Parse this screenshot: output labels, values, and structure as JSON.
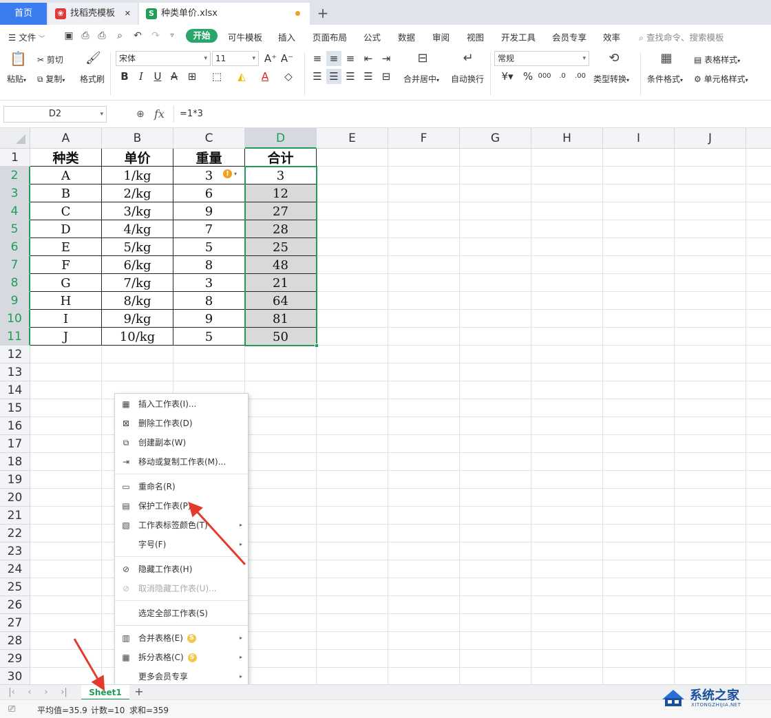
{
  "tabs": {
    "home": "首页",
    "template": "找稻壳模板",
    "file": "种类单价.xlsx",
    "new": "+"
  },
  "menu": {
    "file": "文件",
    "start": "开始",
    "items": [
      "可牛模板",
      "插入",
      "页面布局",
      "公式",
      "数据",
      "审阅",
      "视图",
      "开发工具",
      "会员专享",
      "效率"
    ],
    "search": "查找命令、搜索模板"
  },
  "ribbon": {
    "paste": "粘贴",
    "cut": "剪切",
    "copy": "复制",
    "format_painter": "格式刷",
    "font_name": "宋体",
    "font_size": "11",
    "merge_center": "合并居中",
    "wrap_text": "自动换行",
    "number_format": "常规",
    "type_convert": "类型转换",
    "cond_format": "条件格式",
    "table_style": "表格样式",
    "cell_style": "单元格样式"
  },
  "formula": {
    "cell_ref": "D2",
    "fx": "fx",
    "value": "=1*3"
  },
  "grid": {
    "columns": [
      "A",
      "B",
      "C",
      "D",
      "E",
      "F",
      "G",
      "H",
      "I",
      "J"
    ],
    "rows": [
      "1",
      "2",
      "3",
      "4",
      "5",
      "6",
      "7",
      "8",
      "9",
      "10",
      "11",
      "12",
      "13",
      "14",
      "15",
      "16",
      "17",
      "18",
      "19",
      "20",
      "21",
      "22",
      "23",
      "24",
      "25",
      "26",
      "27",
      "28",
      "29",
      "30"
    ],
    "header": [
      "种类",
      "单价",
      "重量",
      "合计"
    ],
    "data": [
      [
        "A",
        "1/kg",
        "3",
        "3"
      ],
      [
        "B",
        "2/kg",
        "6",
        "12"
      ],
      [
        "C",
        "3/kg",
        "9",
        "27"
      ],
      [
        "D",
        "4/kg",
        "7",
        "28"
      ],
      [
        "E",
        "5/kg",
        "5",
        "25"
      ],
      [
        "F",
        "6/kg",
        "8",
        "48"
      ],
      [
        "G",
        "7/kg",
        "3",
        "21"
      ],
      [
        "H",
        "8/kg",
        "8",
        "64"
      ],
      [
        "I",
        "9/kg",
        "9",
        "81"
      ],
      [
        "J",
        "10/kg",
        "5",
        "50"
      ]
    ],
    "warn": "!"
  },
  "context_menu": [
    {
      "label": "插入工作表(I)...",
      "icon": "insert-sheet-icon",
      "glyph": "▦"
    },
    {
      "label": "删除工作表(D)",
      "icon": "delete-sheet-icon",
      "glyph": "⊠"
    },
    {
      "label": "创建副本(W)",
      "icon": "copy-sheet-icon",
      "glyph": "⧉"
    },
    {
      "label": "移动或复制工作表(M)...",
      "icon": "move-sheet-icon",
      "glyph": "⇥"
    },
    {
      "label": "重命名(R)",
      "icon": "rename-icon",
      "glyph": "▭"
    },
    {
      "label": "保护工作表(P)...",
      "icon": "protect-sheet-icon",
      "glyph": "▤"
    },
    {
      "label": "工作表标签颜色(T)",
      "icon": "tab-color-icon",
      "glyph": "▧"
    },
    {
      "label": "字号(F)",
      "icon": "",
      "glyph": ""
    },
    {
      "label": "隐藏工作表(H)",
      "icon": "hide-eye-icon",
      "glyph": "⊘"
    },
    {
      "label": "取消隐藏工作表(U)...",
      "icon": "unhide-eye-icon",
      "glyph": "⊘"
    },
    {
      "label": "选定全部工作表(S)",
      "icon": "",
      "glyph": ""
    },
    {
      "label": "合并表格(E)",
      "icon": "merge-table-icon",
      "glyph": "▥"
    },
    {
      "label": "拆分表格(C)",
      "icon": "split-table-icon",
      "glyph": "▦"
    },
    {
      "label": "更多会员专享",
      "icon": "",
      "glyph": ""
    }
  ],
  "vip_glyph": "S",
  "sheet": {
    "name": "Sheet1",
    "add": "+"
  },
  "status": {
    "avg": "平均值=35.9",
    "count": "计数=10",
    "sum": "求和=359"
  },
  "watermark": {
    "title": "系统之家",
    "sub": "XITONGZHIJIA.NET"
  },
  "colors": {
    "accent_green": "#1f9d55",
    "home_blue": "#3b7df0",
    "arrow_red": "#e23b2e"
  }
}
